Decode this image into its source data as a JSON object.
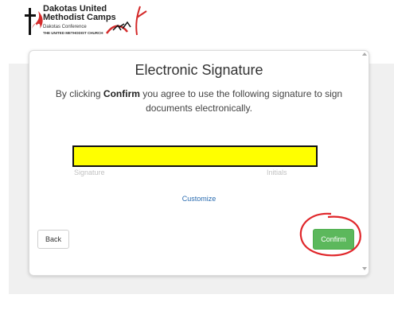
{
  "logo": {
    "name_line1": "Dakotas United",
    "name_line2": "Methodist Camps",
    "sub1": "Dakotas Conference",
    "sub2": "THE UNITED METHODIST CHURCH"
  },
  "dialog": {
    "title": "Electronic Signature",
    "desc_prefix": "By clicking ",
    "desc_bold": "Confirm",
    "desc_suffix": " you agree to use the following signature to sign documents electronically.",
    "signature_label": "Signature",
    "initials_label": "Initials",
    "customize_link": "Customize",
    "back_button": "Back",
    "confirm_button": "Confirm"
  },
  "colors": {
    "confirm": "#5cb85c",
    "link": "#2a6cb0",
    "redaction": "#ffff00",
    "annotation": "#e0262a"
  }
}
